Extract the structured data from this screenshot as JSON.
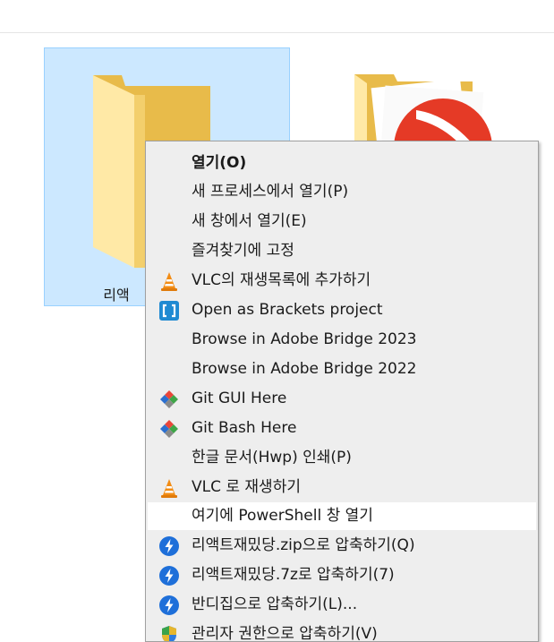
{
  "explorer": {
    "folders": [
      {
        "label": "리액",
        "selected": true
      },
      {
        "label": "",
        "selected": false
      }
    ]
  },
  "context_menu": {
    "items": [
      {
        "label": "열기(O)",
        "icon": "",
        "bold": true
      },
      {
        "label": "새 프로세스에서 열기(P)",
        "icon": ""
      },
      {
        "label": "새 창에서 열기(E)",
        "icon": ""
      },
      {
        "label": "즐겨찾기에 고정",
        "icon": ""
      },
      {
        "label": "VLC의 재생목록에 추가하기",
        "icon": "vlc-cone-icon"
      },
      {
        "label": "Open as Brackets project",
        "icon": "brackets-icon"
      },
      {
        "label": "Browse in Adobe Bridge 2023",
        "icon": ""
      },
      {
        "label": "Browse in Adobe Bridge 2022",
        "icon": ""
      },
      {
        "label": "Git GUI Here",
        "icon": "git-diamond-icon"
      },
      {
        "label": "Git Bash Here",
        "icon": "git-diamond-icon"
      },
      {
        "label": "한글 문서(Hwp) 인쇄(P)",
        "icon": ""
      },
      {
        "label": "VLC 로 재생하기",
        "icon": "vlc-cone-icon"
      },
      {
        "label": "여기에 PowerShell 창 열기",
        "icon": "",
        "highlighted": true
      },
      {
        "label": "리액트재밌당.zip으로 압축하기(Q)",
        "icon": "bandizip-icon"
      },
      {
        "label": "리액트재밌당.7z로 압축하기(7)",
        "icon": "bandizip-icon"
      },
      {
        "label": "반디집으로 압축하기(L)...",
        "icon": "bandizip-icon"
      },
      {
        "label": "관리자 권한으로 압축하기(V)",
        "icon": "shield-icon"
      }
    ]
  },
  "colors": {
    "selection_bg": "#cce8ff",
    "menu_bg": "#eeeeee",
    "highlight_bg": "#ffffff",
    "bandizip_blue": "#1e6fd9",
    "vlc_orange": "#f28c14"
  }
}
